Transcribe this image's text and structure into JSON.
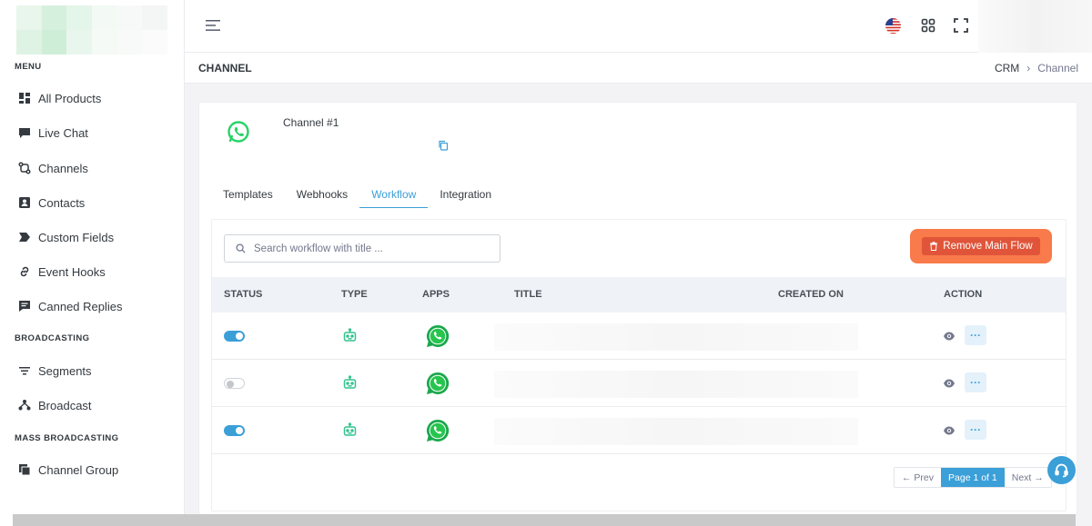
{
  "sidebar": {
    "sections": [
      {
        "title": "MENU"
      },
      {
        "title": "BROADCASTING"
      },
      {
        "title": "MASS BROADCASTING"
      }
    ],
    "items": [
      {
        "label": "All Products",
        "icon": "grid-icon"
      },
      {
        "label": "Live Chat",
        "icon": "chat-icon"
      },
      {
        "label": "Channels",
        "icon": "channels-icon"
      },
      {
        "label": "Contacts",
        "icon": "contacts-icon"
      },
      {
        "label": "Custom Fields",
        "icon": "tag-icon"
      },
      {
        "label": "Event Hooks",
        "icon": "link-icon"
      },
      {
        "label": "Canned Replies",
        "icon": "message-icon"
      },
      {
        "label": "Segments",
        "icon": "filter-icon"
      },
      {
        "label": "Broadcast",
        "icon": "broadcast-icon"
      },
      {
        "label": "Channel Group",
        "icon": "copy-icon"
      }
    ]
  },
  "header": {
    "title": "CHANNEL",
    "breadcrumb": [
      "CRM",
      "Channel"
    ]
  },
  "channel": {
    "name": "Channel #1"
  },
  "tabs": [
    {
      "label": "Templates"
    },
    {
      "label": "Webhooks"
    },
    {
      "label": "Workflow",
      "active": true
    },
    {
      "label": "Integration"
    }
  ],
  "search": {
    "placeholder": "Search workflow with title ...",
    "value": ""
  },
  "actions": {
    "remove_main_flow": "Remove Main Flow"
  },
  "table": {
    "columns": [
      "STATUS",
      "TYPE",
      "APPS",
      "TITLE",
      "CREATED ON",
      "ACTION"
    ],
    "rows": [
      {
        "status": "on",
        "type": "bot-icon",
        "app": "whatsapp-icon",
        "more": "···"
      },
      {
        "status": "off",
        "type": "bot-icon",
        "app": "whatsapp-icon",
        "more": "···"
      },
      {
        "status": "on",
        "type": "bot-icon",
        "app": "whatsapp-icon",
        "more": "···"
      }
    ]
  },
  "pagination": {
    "prev": "← Prev",
    "current": "Page 1 of 1",
    "next": "Next →"
  },
  "colors": {
    "accent": "#3b9fd8",
    "danger": "#e0553a",
    "highlight": "#f97a4a",
    "whatsapp": "#25d366",
    "bot": "#34c38f"
  }
}
